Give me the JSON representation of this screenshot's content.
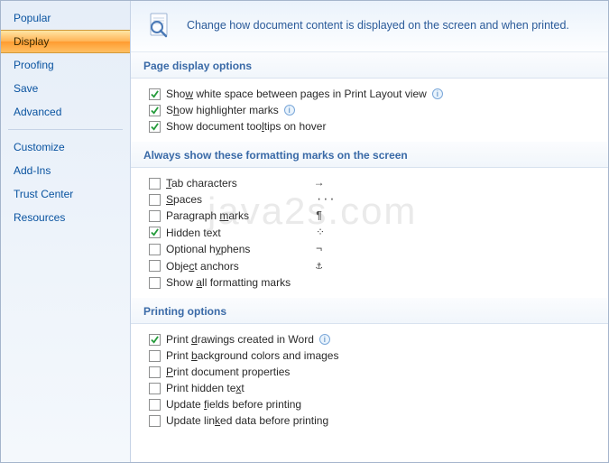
{
  "sidebar": {
    "items": [
      {
        "label": "Popular",
        "active": false
      },
      {
        "label": "Display",
        "active": true
      },
      {
        "label": "Proofing",
        "active": false
      },
      {
        "label": "Save",
        "active": false
      },
      {
        "label": "Advanced",
        "active": false
      }
    ],
    "items2": [
      {
        "label": "Customize",
        "active": false
      },
      {
        "label": "Add-Ins",
        "active": false
      },
      {
        "label": "Trust Center",
        "active": false
      },
      {
        "label": "Resources",
        "active": false
      }
    ]
  },
  "header": {
    "text": "Change how document content is displayed on the screen and when printed."
  },
  "sections": {
    "pageDisplay": {
      "title": "Page display options",
      "options": [
        {
          "label": "Show white space between pages in Print Layout view",
          "checked": true,
          "info": true,
          "u": "w"
        },
        {
          "label": "Show highlighter marks",
          "checked": true,
          "info": true,
          "u": "h"
        },
        {
          "label": "Show document tooltips on hover",
          "checked": true,
          "info": false,
          "u": "l"
        }
      ]
    },
    "formattingMarks": {
      "title": "Always show these formatting marks on the screen",
      "options": [
        {
          "label": "Tab characters",
          "checked": false,
          "mark": "→",
          "u": "T"
        },
        {
          "label": "Spaces",
          "checked": false,
          "mark": "···",
          "u": "S"
        },
        {
          "label": "Paragraph marks",
          "checked": false,
          "mark": "¶",
          "u": "m"
        },
        {
          "label": "Hidden text",
          "checked": true,
          "mark": "⁘",
          "u": ""
        },
        {
          "label": "Optional hyphens",
          "checked": false,
          "mark": "¬",
          "u": "y"
        },
        {
          "label": "Object anchors",
          "checked": false,
          "mark": "⚓",
          "u": "c"
        },
        {
          "label": "Show all formatting marks",
          "checked": false,
          "mark": "",
          "u": "a"
        }
      ]
    },
    "printing": {
      "title": "Printing options",
      "options": [
        {
          "label": "Print drawings created in Word",
          "checked": true,
          "info": true,
          "u": "d"
        },
        {
          "label": "Print background colors and images",
          "checked": false,
          "info": false,
          "u": "b"
        },
        {
          "label": "Print document properties",
          "checked": false,
          "info": false,
          "u": "p"
        },
        {
          "label": "Print hidden text",
          "checked": false,
          "info": false,
          "u": "x"
        },
        {
          "label": "Update fields before printing",
          "checked": false,
          "info": false,
          "u": "f"
        },
        {
          "label": "Update linked data before printing",
          "checked": false,
          "info": false,
          "u": "k"
        }
      ]
    }
  },
  "watermark": "java2s.com"
}
